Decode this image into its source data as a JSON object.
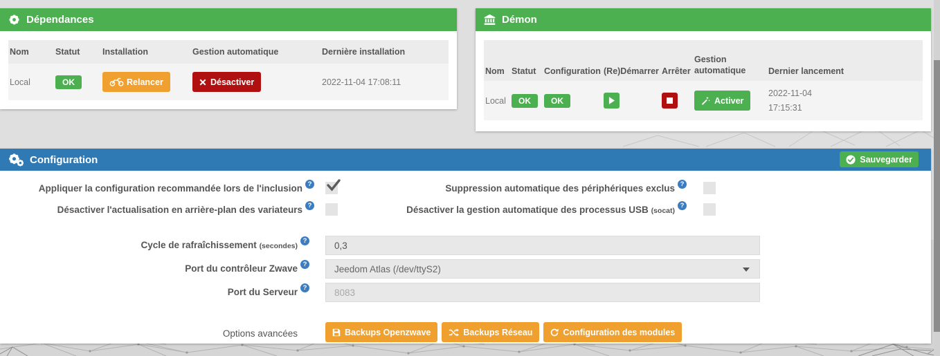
{
  "colors": {
    "green": "#4caf50",
    "blue": "#2f79b4",
    "orange": "#efa02e",
    "red": "#b11010",
    "page_bg": "#dfdfdf"
  },
  "icons": {
    "dependencies": "cog-icon",
    "daemon": "bank-icon",
    "configuration": "cogs-icon",
    "relaunch": "motorcycle-icon",
    "disable": "x-icon",
    "enable": "magic-wand-icon",
    "save": "check-circle-icon",
    "start": "play-icon",
    "stop": "stop-icon",
    "help": "question-circle-icon",
    "backup_openzwave": "floppy-icon",
    "backup_network": "shuffle-icon",
    "module_config": "refresh-icon",
    "select_caret": "caret-down-icon",
    "help_glyph": "?"
  },
  "dependencies": {
    "title": "Dépendances",
    "headers": [
      "Nom",
      "Statut",
      "Installation",
      "Gestion automatique",
      "Dernière installation"
    ],
    "row": {
      "name": "Local",
      "status": "OK",
      "relaunch_label": "Relancer",
      "disable_label": "Désactiver",
      "last_install": "2022-11-04 17:08:11"
    }
  },
  "daemon": {
    "title": "Démon",
    "headers": [
      "Nom",
      "Statut",
      "Configuration",
      "(Re)Démarrer",
      "Arrêter",
      "Gestion automatique",
      "Dernier lancement"
    ],
    "row": {
      "name": "Local",
      "status": "OK",
      "config_status": "OK",
      "enable_label": "Activer",
      "last_launch_date": "2022-11-04",
      "last_launch_time": "17:15:31"
    }
  },
  "configuration": {
    "title": "Configuration",
    "save_label": "Sauvegarder",
    "checkboxes": [
      {
        "label": "Appliquer la configuration recommandée lors de l'inclusion",
        "checked": true
      },
      {
        "label": "Suppression automatique des périphériques exclus",
        "checked": false
      },
      {
        "label": "Désactiver l'actualisation en arrière-plan des variateurs",
        "checked": false
      },
      {
        "label": "Désactiver la gestion automatique des processus USB",
        "suffix": "(socat)",
        "checked": false
      }
    ],
    "fields": {
      "refresh_cycle": {
        "label": "Cycle de rafraîchissement",
        "suffix": "(secondes)",
        "value": "0,3"
      },
      "zwave_port": {
        "label": "Port du contrôleur Zwave",
        "value": "Jeedom Atlas (/dev/ttyS2)"
      },
      "server_port": {
        "label": "Port du Serveur",
        "placeholder": "8083"
      },
      "advanced": {
        "label": "Options avancées",
        "buttons": [
          "Backups Openzwave",
          "Backups Réseau",
          "Configuration des modules"
        ]
      }
    }
  }
}
